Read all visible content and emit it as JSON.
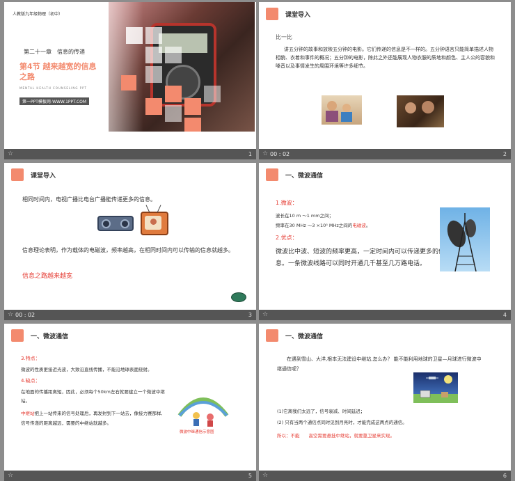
{
  "slides": [
    {
      "number": "1",
      "top_label": "人教版九年级物理（初中）",
      "chapter": "第二十一章　信息的传递",
      "title_line1": "第4节  越来越宽的信息",
      "title_line2": "之路",
      "subtitle_en": "MENTAL HEALTH COUNSELING PPT",
      "website": "第一PPT模板网-WWW.1PPT.COM"
    },
    {
      "number": "2",
      "time": "00 : 02",
      "title": "课堂导入",
      "subhead": "比一比",
      "body": "讲五分钟的故事和放映五分钟的电影。它们传递的信息是不一样的。五分钟语言只能简单描述人物相貌、衣着和事件的概况；五分钟的电影，除此之外还能展现人物衣服的质地和颜色、主人公的容貌和嗓音以及事情发生的周围环境等许多细节。"
    },
    {
      "number": "3",
      "time": "00 : 02",
      "title": "课堂导入",
      "line1": "相同时间内，电视广播比电台广播能传递更多的信息。",
      "line2": "信息理论表明，作为载体的电磁波，频率越高，在相同时间内可以传输的信息就越多。",
      "conclusion": "信息之路越来越宽"
    },
    {
      "number": "4",
      "title": "一、微波通信",
      "label1": "1.微波：",
      "wave1": "波长在10 m  ～1 mm之间；",
      "wave2a": "频率在30 MHz  ～3 ×10⁵ MHz之间的",
      "wave2b": "电磁波",
      "wave2c": "。",
      "label2": "2.优点：",
      "body": "微波比中波、短波的频率更高，一定时间内可以传递更多的信息。一条微波线路可以同时开通几千甚至几万路电话。"
    },
    {
      "number": "5",
      "title": "一、微波通信",
      "label1": "3.特点：",
      "feature": "微波的性质更接近光波，大致沿直线传播，不能沿地球表面绕射。",
      "label2": "4.缺点：",
      "drawback": "在地面的传播距离短，因此，必须每个50km左右就要建立一个微波中继站。",
      "relay_term": "中继站",
      "relay_desc": "把上一站传来的信号处理后，再发射到下一站去，像接力赛那样,信号传递的距离越远，需要的中继站就越多。",
      "caption": "微波中继通信示意图"
    },
    {
      "number": "6",
      "title": "一、微波通信",
      "question": "在遇到雪山、大洋,根本无法建设中继站,怎么办？ 能不能利用地球的卫星—月球进行微波中继通信呢？",
      "reason1": "(1)它离我们太远了，信号衰减、时间延迟；",
      "reason2": "(2) 只有当两个通信点同时见到月亮时，才能完成这两点的通信。",
      "answer": "所以：不能　　高空需要悬挂中继站，就要靠卫星来实现。"
    }
  ]
}
